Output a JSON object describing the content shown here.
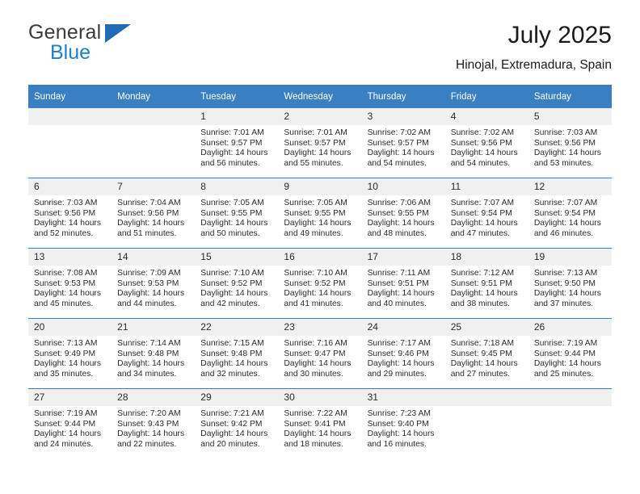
{
  "brand": {
    "name_top": "General",
    "name_bottom": "Blue",
    "flag_color": "#1f6cb4",
    "blue_color": "#1f7fd1"
  },
  "header": {
    "title": "July 2025",
    "location": "Hinojal, Extremadura, Spain"
  },
  "theme": {
    "header_bg": "#3a7fc1",
    "daynum_bg": "#f0f0f0",
    "row_border": "#3a7fc1"
  },
  "weekday_headers": [
    "Sunday",
    "Monday",
    "Tuesday",
    "Wednesday",
    "Thursday",
    "Friday",
    "Saturday"
  ],
  "weeks": [
    [
      {
        "day": "",
        "sunrise": "",
        "sunset": "",
        "daylight_1": "",
        "daylight_2": ""
      },
      {
        "day": "",
        "sunrise": "",
        "sunset": "",
        "daylight_1": "",
        "daylight_2": ""
      },
      {
        "day": "1",
        "sunrise": "Sunrise: 7:01 AM",
        "sunset": "Sunset: 9:57 PM",
        "daylight_1": "Daylight: 14 hours",
        "daylight_2": "and 56 minutes."
      },
      {
        "day": "2",
        "sunrise": "Sunrise: 7:01 AM",
        "sunset": "Sunset: 9:57 PM",
        "daylight_1": "Daylight: 14 hours",
        "daylight_2": "and 55 minutes."
      },
      {
        "day": "3",
        "sunrise": "Sunrise: 7:02 AM",
        "sunset": "Sunset: 9:57 PM",
        "daylight_1": "Daylight: 14 hours",
        "daylight_2": "and 54 minutes."
      },
      {
        "day": "4",
        "sunrise": "Sunrise: 7:02 AM",
        "sunset": "Sunset: 9:56 PM",
        "daylight_1": "Daylight: 14 hours",
        "daylight_2": "and 54 minutes."
      },
      {
        "day": "5",
        "sunrise": "Sunrise: 7:03 AM",
        "sunset": "Sunset: 9:56 PM",
        "daylight_1": "Daylight: 14 hours",
        "daylight_2": "and 53 minutes."
      }
    ],
    [
      {
        "day": "6",
        "sunrise": "Sunrise: 7:03 AM",
        "sunset": "Sunset: 9:56 PM",
        "daylight_1": "Daylight: 14 hours",
        "daylight_2": "and 52 minutes."
      },
      {
        "day": "7",
        "sunrise": "Sunrise: 7:04 AM",
        "sunset": "Sunset: 9:56 PM",
        "daylight_1": "Daylight: 14 hours",
        "daylight_2": "and 51 minutes."
      },
      {
        "day": "8",
        "sunrise": "Sunrise: 7:05 AM",
        "sunset": "Sunset: 9:55 PM",
        "daylight_1": "Daylight: 14 hours",
        "daylight_2": "and 50 minutes."
      },
      {
        "day": "9",
        "sunrise": "Sunrise: 7:05 AM",
        "sunset": "Sunset: 9:55 PM",
        "daylight_1": "Daylight: 14 hours",
        "daylight_2": "and 49 minutes."
      },
      {
        "day": "10",
        "sunrise": "Sunrise: 7:06 AM",
        "sunset": "Sunset: 9:55 PM",
        "daylight_1": "Daylight: 14 hours",
        "daylight_2": "and 48 minutes."
      },
      {
        "day": "11",
        "sunrise": "Sunrise: 7:07 AM",
        "sunset": "Sunset: 9:54 PM",
        "daylight_1": "Daylight: 14 hours",
        "daylight_2": "and 47 minutes."
      },
      {
        "day": "12",
        "sunrise": "Sunrise: 7:07 AM",
        "sunset": "Sunset: 9:54 PM",
        "daylight_1": "Daylight: 14 hours",
        "daylight_2": "and 46 minutes."
      }
    ],
    [
      {
        "day": "13",
        "sunrise": "Sunrise: 7:08 AM",
        "sunset": "Sunset: 9:53 PM",
        "daylight_1": "Daylight: 14 hours",
        "daylight_2": "and 45 minutes."
      },
      {
        "day": "14",
        "sunrise": "Sunrise: 7:09 AM",
        "sunset": "Sunset: 9:53 PM",
        "daylight_1": "Daylight: 14 hours",
        "daylight_2": "and 44 minutes."
      },
      {
        "day": "15",
        "sunrise": "Sunrise: 7:10 AM",
        "sunset": "Sunset: 9:52 PM",
        "daylight_1": "Daylight: 14 hours",
        "daylight_2": "and 42 minutes."
      },
      {
        "day": "16",
        "sunrise": "Sunrise: 7:10 AM",
        "sunset": "Sunset: 9:52 PM",
        "daylight_1": "Daylight: 14 hours",
        "daylight_2": "and 41 minutes."
      },
      {
        "day": "17",
        "sunrise": "Sunrise: 7:11 AM",
        "sunset": "Sunset: 9:51 PM",
        "daylight_1": "Daylight: 14 hours",
        "daylight_2": "and 40 minutes."
      },
      {
        "day": "18",
        "sunrise": "Sunrise: 7:12 AM",
        "sunset": "Sunset: 9:51 PM",
        "daylight_1": "Daylight: 14 hours",
        "daylight_2": "and 38 minutes."
      },
      {
        "day": "19",
        "sunrise": "Sunrise: 7:13 AM",
        "sunset": "Sunset: 9:50 PM",
        "daylight_1": "Daylight: 14 hours",
        "daylight_2": "and 37 minutes."
      }
    ],
    [
      {
        "day": "20",
        "sunrise": "Sunrise: 7:13 AM",
        "sunset": "Sunset: 9:49 PM",
        "daylight_1": "Daylight: 14 hours",
        "daylight_2": "and 35 minutes."
      },
      {
        "day": "21",
        "sunrise": "Sunrise: 7:14 AM",
        "sunset": "Sunset: 9:48 PM",
        "daylight_1": "Daylight: 14 hours",
        "daylight_2": "and 34 minutes."
      },
      {
        "day": "22",
        "sunrise": "Sunrise: 7:15 AM",
        "sunset": "Sunset: 9:48 PM",
        "daylight_1": "Daylight: 14 hours",
        "daylight_2": "and 32 minutes."
      },
      {
        "day": "23",
        "sunrise": "Sunrise: 7:16 AM",
        "sunset": "Sunset: 9:47 PM",
        "daylight_1": "Daylight: 14 hours",
        "daylight_2": "and 30 minutes."
      },
      {
        "day": "24",
        "sunrise": "Sunrise: 7:17 AM",
        "sunset": "Sunset: 9:46 PM",
        "daylight_1": "Daylight: 14 hours",
        "daylight_2": "and 29 minutes."
      },
      {
        "day": "25",
        "sunrise": "Sunrise: 7:18 AM",
        "sunset": "Sunset: 9:45 PM",
        "daylight_1": "Daylight: 14 hours",
        "daylight_2": "and 27 minutes."
      },
      {
        "day": "26",
        "sunrise": "Sunrise: 7:19 AM",
        "sunset": "Sunset: 9:44 PM",
        "daylight_1": "Daylight: 14 hours",
        "daylight_2": "and 25 minutes."
      }
    ],
    [
      {
        "day": "27",
        "sunrise": "Sunrise: 7:19 AM",
        "sunset": "Sunset: 9:44 PM",
        "daylight_1": "Daylight: 14 hours",
        "daylight_2": "and 24 minutes."
      },
      {
        "day": "28",
        "sunrise": "Sunrise: 7:20 AM",
        "sunset": "Sunset: 9:43 PM",
        "daylight_1": "Daylight: 14 hours",
        "daylight_2": "and 22 minutes."
      },
      {
        "day": "29",
        "sunrise": "Sunrise: 7:21 AM",
        "sunset": "Sunset: 9:42 PM",
        "daylight_1": "Daylight: 14 hours",
        "daylight_2": "and 20 minutes."
      },
      {
        "day": "30",
        "sunrise": "Sunrise: 7:22 AM",
        "sunset": "Sunset: 9:41 PM",
        "daylight_1": "Daylight: 14 hours",
        "daylight_2": "and 18 minutes."
      },
      {
        "day": "31",
        "sunrise": "Sunrise: 7:23 AM",
        "sunset": "Sunset: 9:40 PM",
        "daylight_1": "Daylight: 14 hours",
        "daylight_2": "and 16 minutes."
      },
      {
        "day": "",
        "sunrise": "",
        "sunset": "",
        "daylight_1": "",
        "daylight_2": ""
      },
      {
        "day": "",
        "sunrise": "",
        "sunset": "",
        "daylight_1": "",
        "daylight_2": ""
      }
    ]
  ]
}
